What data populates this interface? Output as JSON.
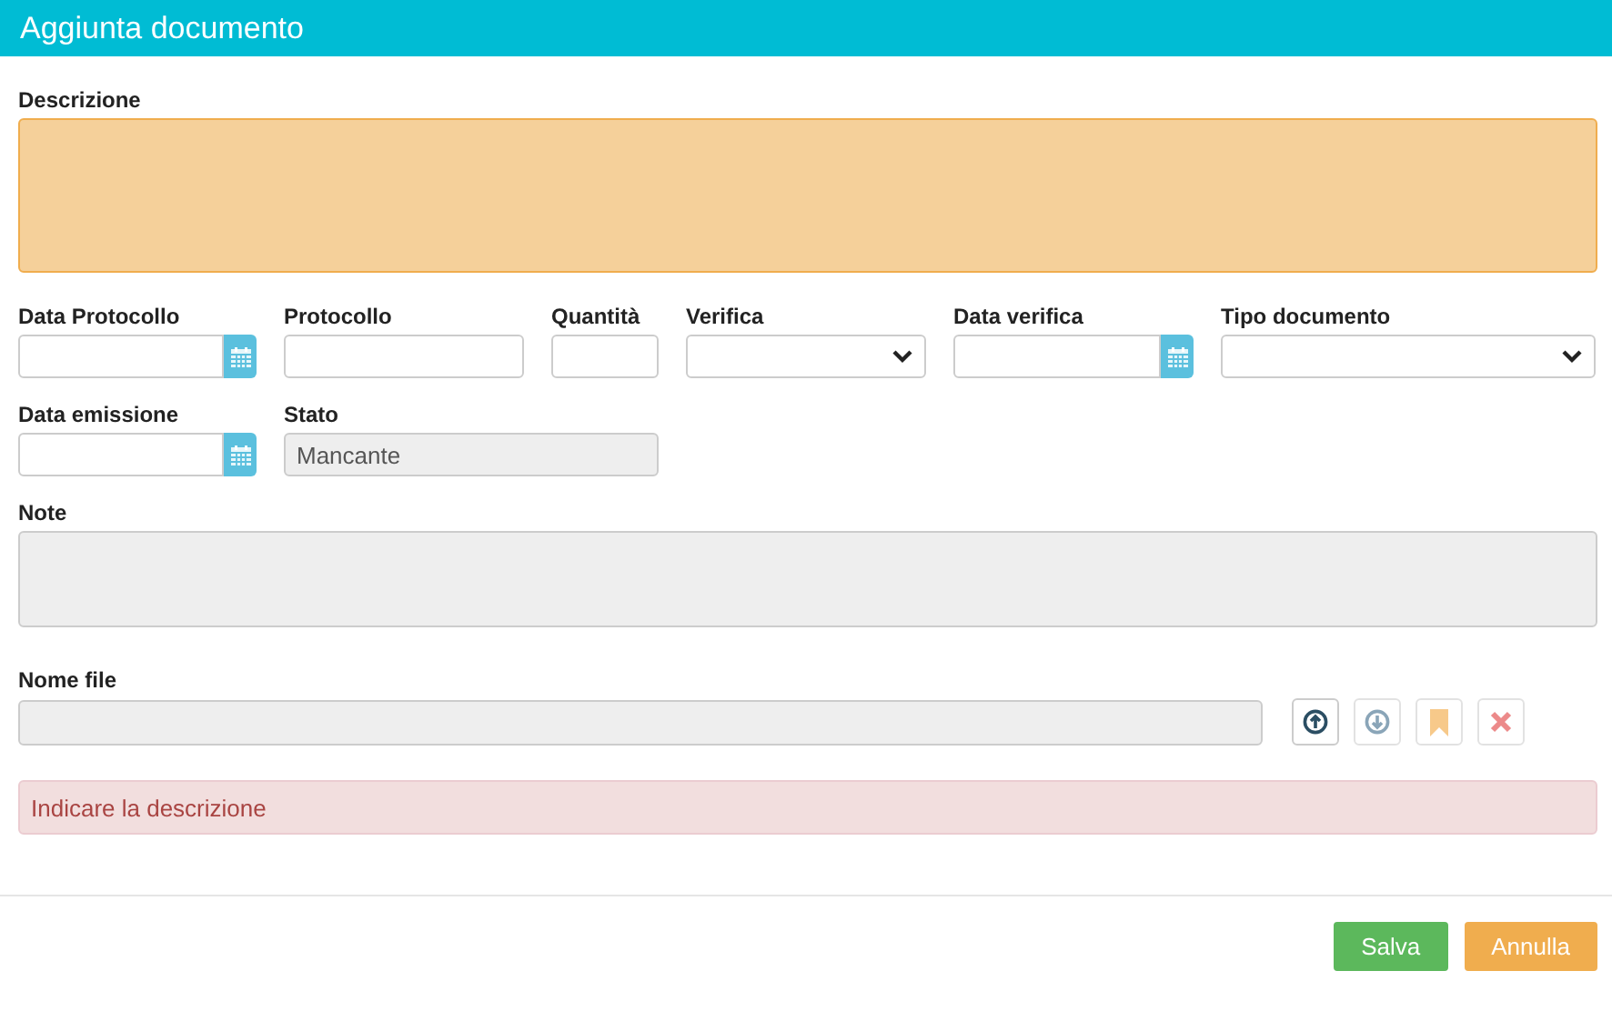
{
  "window": {
    "title": "Aggiunta documento"
  },
  "description": {
    "label": "Descrizione",
    "invalid": true
  },
  "field_rows": [
    [
      {
        "label": "Data Protocollo",
        "kind": "date",
        "disabled": false
      },
      {
        "label": "Protocollo",
        "kind": "text",
        "disabled": false
      },
      {
        "label": "Quantità",
        "kind": "text",
        "disabled": false
      },
      {
        "label": "Verifica",
        "kind": "select",
        "disabled": false
      },
      {
        "label": "Data verifica",
        "kind": "date",
        "disabled": false
      },
      {
        "label": "Tipo documento",
        "kind": "select",
        "disabled": false
      }
    ],
    [
      {
        "label": "Data emissione",
        "kind": "date",
        "disabled": false
      },
      {
        "label": "Stato",
        "kind": "text",
        "value": "Mancante",
        "disabled": true
      }
    ]
  ],
  "note": {
    "label": "Note",
    "disabled": true
  },
  "file": {
    "label": "Nome file",
    "disabled": true,
    "actions": [
      {
        "kind": "upload",
        "disabled": false
      },
      {
        "kind": "download",
        "disabled": true
      },
      {
        "kind": "bookmark",
        "disabled": true
      },
      {
        "kind": "delete",
        "disabled": true
      }
    ]
  },
  "alert": {
    "text": "Indicare la descrizione"
  },
  "buttons": [
    {
      "label": "Salva",
      "kind": "primary"
    },
    {
      "label": "Annulla",
      "kind": "cancel"
    }
  ]
}
